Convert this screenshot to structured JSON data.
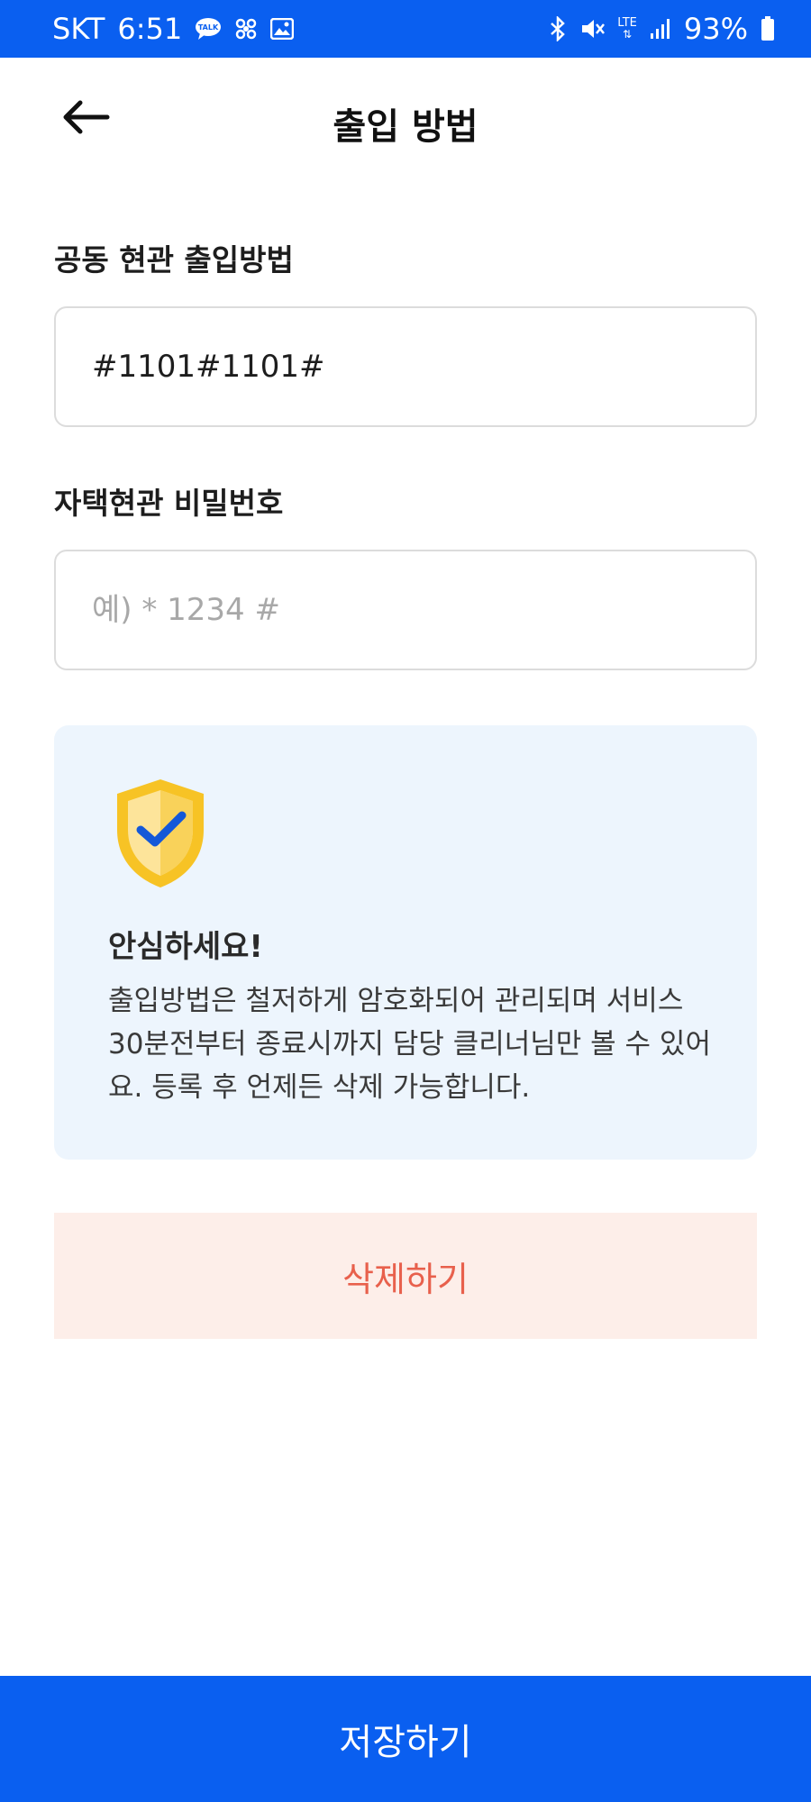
{
  "status_bar": {
    "carrier": "SKT",
    "time": "6:51",
    "network": "LTE",
    "battery": "93%",
    "left_icons": [
      "talk-icon",
      "cluster-icon",
      "image-icon"
    ],
    "right_icons": [
      "bluetooth-icon",
      "mute-icon",
      "lte-icon",
      "signal-icon",
      "battery-icon"
    ]
  },
  "header": {
    "title": "출입 방법",
    "back_icon": "arrow-left-icon"
  },
  "form": {
    "common_entrance_label": "공동 현관 출입방법",
    "common_entrance_value": "#1101#1101#",
    "home_entrance_label": "자택현관 비밀번호",
    "home_entrance_value": "",
    "home_entrance_placeholder": "예) * 1234 #"
  },
  "info": {
    "icon": "shield-check-icon",
    "title": "안심하세요!",
    "body": "출입방법은 철저하게 암호화되어 관리되며 서비스 30분전부터 종료시까지 담당 클리너님만 볼 수 있어요. 등록 후 언제든 삭제 가능합니다."
  },
  "actions": {
    "delete_label": "삭제하기",
    "save_label": "저장하기"
  },
  "colors": {
    "primary": "#0a5ff0",
    "info_bg": "#edf5fd",
    "delete_bg": "#fdeee9",
    "delete_text": "#e8604c",
    "shield_yellow": "#f7c325"
  }
}
